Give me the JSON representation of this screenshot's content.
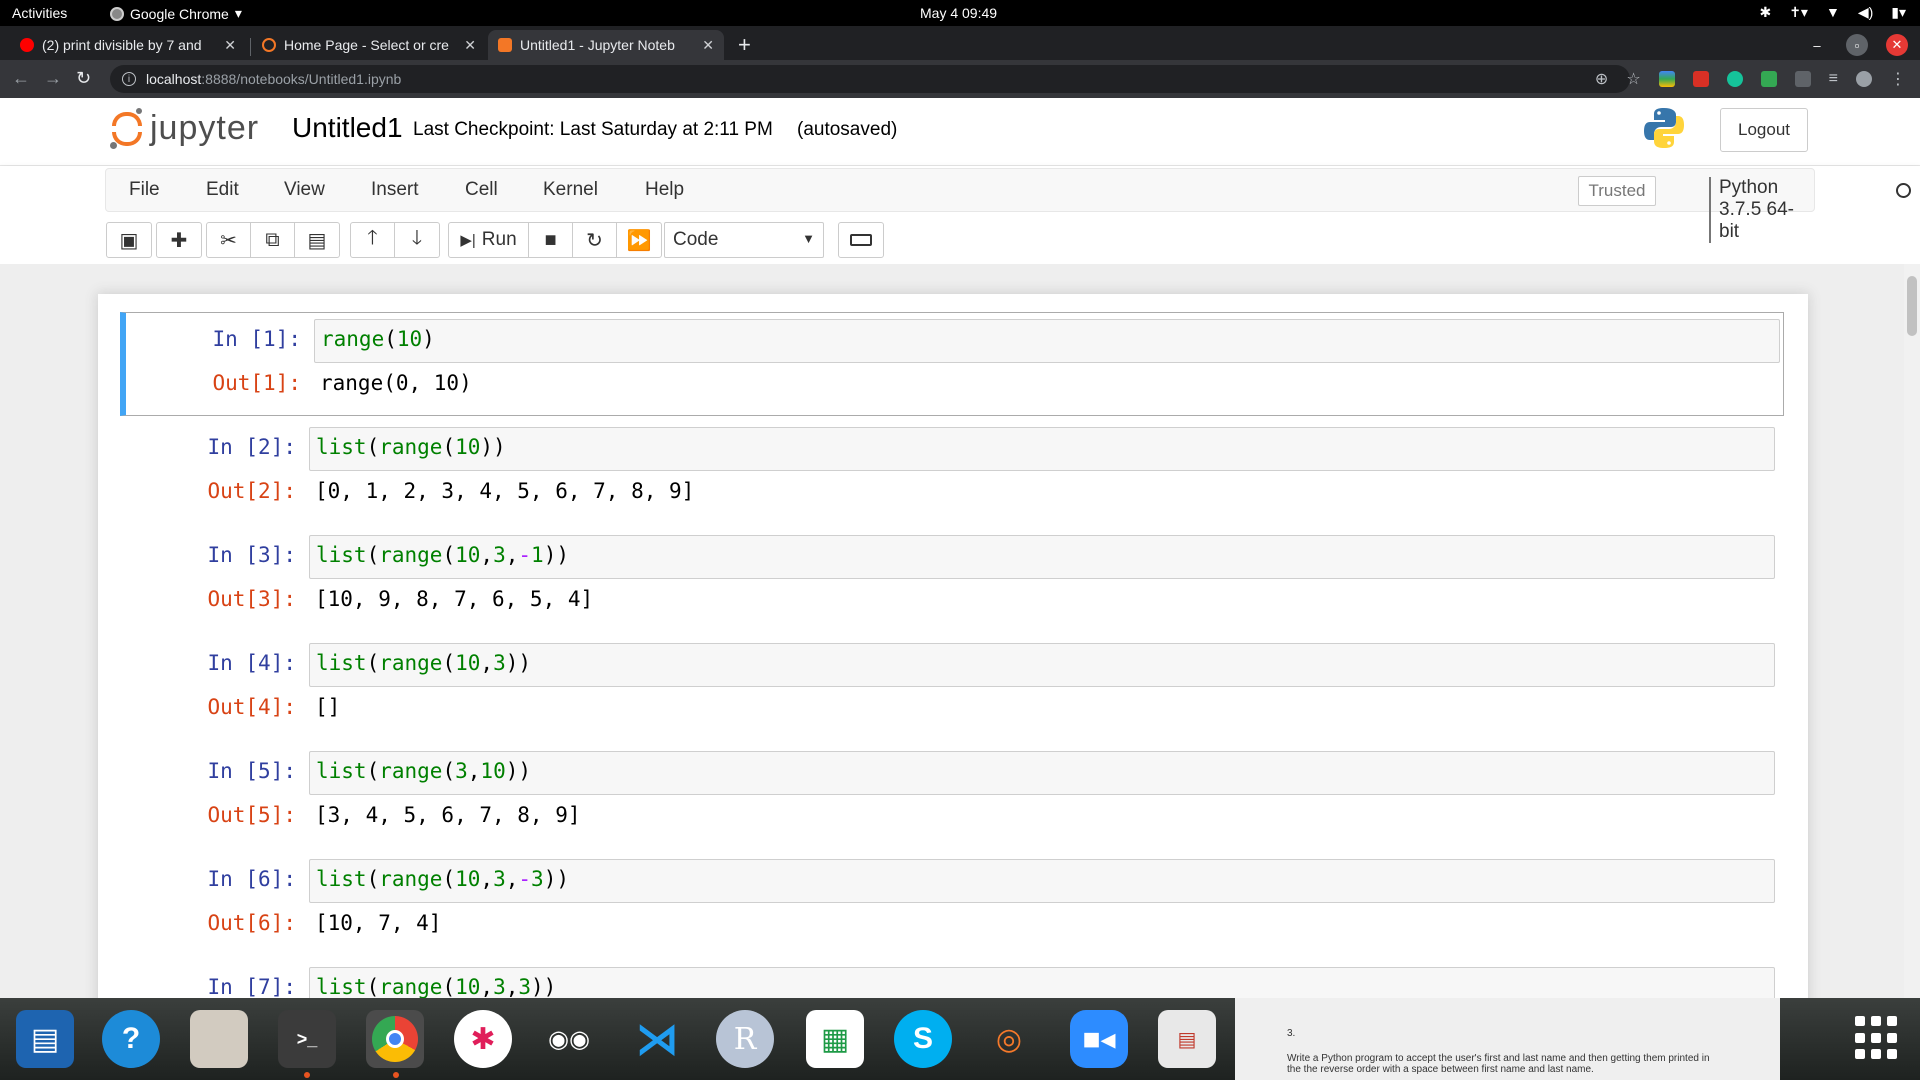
{
  "topbar": {
    "activities": "Activities",
    "app": "Google Chrome",
    "clock": "May 4  09:49"
  },
  "tabs": [
    {
      "title": "(2) print divisible by 7 and",
      "icon": "youtube-icon",
      "color": "#ff0000"
    },
    {
      "title": "Home Page - Select or cre",
      "icon": "jupyter-icon",
      "color": "#f37726"
    },
    {
      "title": "Untitled1 - Jupyter Noteb",
      "icon": "jupyter-icon",
      "color": "#f37726"
    }
  ],
  "address": {
    "host": "localhost",
    "path": ":8888/notebooks/Untitled1.ipynb"
  },
  "jupyter": {
    "logo_text": "jupyter",
    "notebook_name": "Untitled1",
    "checkpoint": "Last Checkpoint: Last Saturday at 2:11 PM",
    "autosave": "(autosaved)",
    "logout": "Logout",
    "menu": [
      "File",
      "Edit",
      "View",
      "Insert",
      "Cell",
      "Kernel",
      "Help"
    ],
    "trusted": "Trusted",
    "kernel": "Python 3.7.5 64-bit",
    "run_label": "Run",
    "cell_type": "Code",
    "accent": "#f37726"
  },
  "cells": [
    {
      "in": "In [1]:",
      "code": [
        [
          "fn",
          "range"
        ],
        [
          "pun",
          "("
        ],
        [
          "num",
          "10"
        ],
        [
          "pun",
          ")"
        ]
      ],
      "out_prompt": "Out[1]:",
      "output": "range(0, 10)"
    },
    {
      "in": "In [2]:",
      "code": [
        [
          "fn",
          "list"
        ],
        [
          "pun",
          "("
        ],
        [
          "fn",
          "range"
        ],
        [
          "pun",
          "("
        ],
        [
          "num",
          "10"
        ],
        [
          "pun",
          "))"
        ]
      ],
      "out_prompt": "Out[2]:",
      "output": "[0, 1, 2, 3, 4, 5, 6, 7, 8, 9]"
    },
    {
      "in": "In [3]:",
      "code": [
        [
          "fn",
          "list"
        ],
        [
          "pun",
          "("
        ],
        [
          "fn",
          "range"
        ],
        [
          "pun",
          "("
        ],
        [
          "num",
          "10"
        ],
        [
          "pun",
          ","
        ],
        [
          "num",
          "3"
        ],
        [
          "pun",
          ","
        ],
        [
          "op",
          "-"
        ],
        [
          "num",
          "1"
        ],
        [
          "pun",
          "))"
        ]
      ],
      "out_prompt": "Out[3]:",
      "output": "[10, 9, 8, 7, 6, 5, 4]"
    },
    {
      "in": "In [4]:",
      "code": [
        [
          "fn",
          "list"
        ],
        [
          "pun",
          "("
        ],
        [
          "fn",
          "range"
        ],
        [
          "pun",
          "("
        ],
        [
          "num",
          "10"
        ],
        [
          "pun",
          ","
        ],
        [
          "num",
          "3"
        ],
        [
          "pun",
          "))"
        ]
      ],
      "out_prompt": "Out[4]:",
      "output": "[]"
    },
    {
      "in": "In [5]:",
      "code": [
        [
          "fn",
          "list"
        ],
        [
          "pun",
          "("
        ],
        [
          "fn",
          "range"
        ],
        [
          "pun",
          "("
        ],
        [
          "num",
          "3"
        ],
        [
          "pun",
          ","
        ],
        [
          "num",
          "10"
        ],
        [
          "pun",
          "))"
        ]
      ],
      "out_prompt": "Out[5]:",
      "output": "[3, 4, 5, 6, 7, 8, 9]"
    },
    {
      "in": "In [6]:",
      "code": [
        [
          "fn",
          "list"
        ],
        [
          "pun",
          "("
        ],
        [
          "fn",
          "range"
        ],
        [
          "pun",
          "("
        ],
        [
          "num",
          "10"
        ],
        [
          "pun",
          ","
        ],
        [
          "num",
          "3"
        ],
        [
          "pun",
          ","
        ],
        [
          "op",
          "-"
        ],
        [
          "num",
          "3"
        ],
        [
          "pun",
          "))"
        ]
      ],
      "out_prompt": "Out[6]:",
      "output": "[10, 7, 4]"
    },
    {
      "in": "In [7]:",
      "code": [
        [
          "fn",
          "list"
        ],
        [
          "pun",
          "("
        ],
        [
          "fn",
          "range"
        ],
        [
          "pun",
          "("
        ],
        [
          "num",
          "10"
        ],
        [
          "pun",
          ","
        ],
        [
          "num",
          "3"
        ],
        [
          "pun",
          ","
        ],
        [
          "num",
          "3"
        ],
        [
          "pun",
          "))"
        ]
      ],
      "out_prompt": "",
      "output": ""
    }
  ],
  "dock": {
    "preview_line1": "3.",
    "preview_line2": "Write a Python program to accept the user's first and last name and then getting them printed in",
    "preview_line3": "the the reverse order with a space between first name and last name."
  }
}
